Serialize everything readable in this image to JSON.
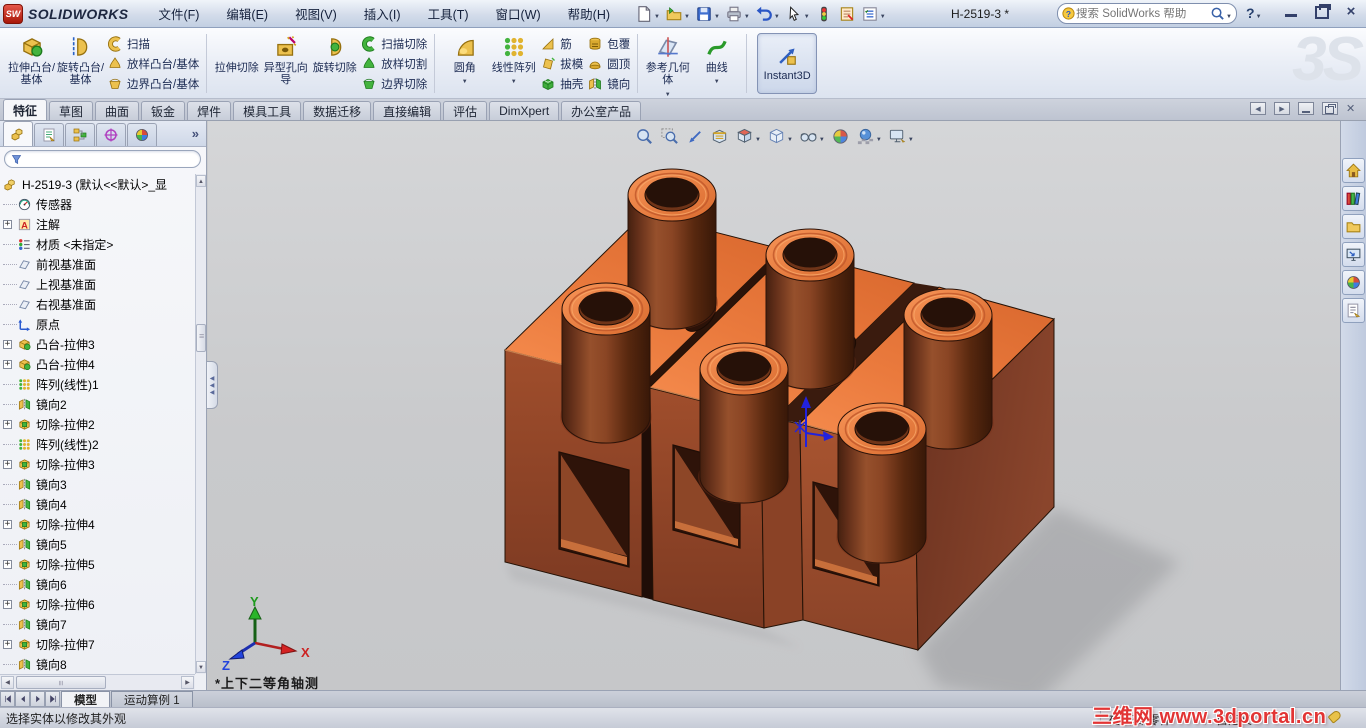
{
  "window": {
    "app_logo": "SOLIDWORKS",
    "logo_badge": "SW",
    "title": "H-2519-3 *",
    "search_placeholder": "搜索 SolidWorks 帮助",
    "help_label": "?"
  },
  "menus": [
    "文件(F)",
    "编辑(E)",
    "视图(V)",
    "插入(I)",
    "工具(T)",
    "窗口(W)",
    "帮助(H)"
  ],
  "quick_toolbar": [
    {
      "icon": "new-document-icon",
      "dropdown": true
    },
    {
      "icon": "open-icon",
      "dropdown": true
    },
    {
      "icon": "save-icon",
      "dropdown": true
    },
    {
      "icon": "print-icon",
      "dropdown": true
    },
    {
      "icon": "undo-icon",
      "dropdown": true
    },
    {
      "icon": "select-icon",
      "dropdown": true
    },
    {
      "icon": "traffic-light-icon",
      "dropdown": false
    },
    {
      "icon": "rebuild-icon",
      "dropdown": false
    },
    {
      "icon": "options-icon",
      "dropdown": true
    }
  ],
  "ribbon": {
    "g1": {
      "b1": "拉伸凸台/基体",
      "b2": "旋转凸台/基体",
      "s1": "扫描",
      "s2": "放样凸台/基体",
      "s3": "边界凸台/基体"
    },
    "g2": {
      "b1": "拉伸切除",
      "b2": "异型孔向导",
      "b3": "旋转切除",
      "s1": "扫描切除",
      "s2": "放样切割",
      "s3": "边界切除"
    },
    "g3": {
      "b1": "圆角",
      "b2": "线性阵列",
      "s1": "筋",
      "s2": "拔模",
      "s3": "抽壳",
      "s4": "包覆",
      "s5": "圆顶",
      "s6": "镜向"
    },
    "g4": {
      "b1": "参考几何体",
      "b2": "曲线"
    },
    "instant3d": "Instant3D",
    "watermark": "3S"
  },
  "command_tabs": [
    "特征",
    "草图",
    "曲面",
    "钣金",
    "焊件",
    "模具工具",
    "数据迁移",
    "直接编辑",
    "评估",
    "DimXpert",
    "办公室产品"
  ],
  "command_tabs_active": 0,
  "panel_tabs": [
    "featuremanager-icon",
    "propertymanager-icon",
    "configurations-icon",
    "dimxpert-icon",
    "displaymanager-icon"
  ],
  "feature_tree": {
    "root": "H-2519-3  (默认<<默认>_显",
    "items": [
      {
        "label": "传感器",
        "icon": "sensors-icon",
        "exp": false
      },
      {
        "label": "注解",
        "icon": "annotations-icon",
        "exp": true
      },
      {
        "label": "材质 <未指定>",
        "icon": "material-icon",
        "exp": false
      },
      {
        "label": "前视基准面",
        "icon": "plane-icon",
        "exp": false
      },
      {
        "label": "上视基准面",
        "icon": "plane-icon",
        "exp": false
      },
      {
        "label": "右视基准面",
        "icon": "plane-icon",
        "exp": false
      },
      {
        "label": "原点",
        "icon": "origin-icon",
        "exp": false
      },
      {
        "label": "凸台-拉伸3",
        "icon": "boss-extrude-icon",
        "exp": true
      },
      {
        "label": "凸台-拉伸4",
        "icon": "boss-extrude-icon",
        "exp": true
      },
      {
        "label": "阵列(线性)1",
        "icon": "linear-pattern-icon",
        "exp": false
      },
      {
        "label": "镜向2",
        "icon": "mirror-icon",
        "exp": false
      },
      {
        "label": "切除-拉伸2",
        "icon": "cut-extrude-icon",
        "exp": true
      },
      {
        "label": "阵列(线性)2",
        "icon": "linear-pattern-icon",
        "exp": false
      },
      {
        "label": "切除-拉伸3",
        "icon": "cut-extrude-icon",
        "exp": true
      },
      {
        "label": "镜向3",
        "icon": "mirror-icon",
        "exp": false
      },
      {
        "label": "镜向4",
        "icon": "mirror-icon",
        "exp": false
      },
      {
        "label": "切除-拉伸4",
        "icon": "cut-extrude-icon",
        "exp": true
      },
      {
        "label": "镜向5",
        "icon": "mirror-icon",
        "exp": false
      },
      {
        "label": "切除-拉伸5",
        "icon": "cut-extrude-icon",
        "exp": true
      },
      {
        "label": "镜向6",
        "icon": "mirror-icon",
        "exp": false
      },
      {
        "label": "切除-拉伸6",
        "icon": "cut-extrude-icon",
        "exp": true
      },
      {
        "label": "镜向7",
        "icon": "mirror-icon",
        "exp": false
      },
      {
        "label": "切除-拉伸7",
        "icon": "cut-extrude-icon",
        "exp": true
      },
      {
        "label": "镜向8",
        "icon": "mirror-icon",
        "exp": false
      }
    ]
  },
  "headsup": [
    {
      "icon": "zoom-fit-icon",
      "dropdown": false
    },
    {
      "icon": "zoom-area-icon",
      "dropdown": false
    },
    {
      "icon": "previous-view-icon",
      "dropdown": false
    },
    {
      "icon": "section-view-icon",
      "dropdown": false
    },
    {
      "icon": "view-orientation-icon",
      "dropdown": true
    },
    {
      "icon": "display-style-icon",
      "dropdown": true
    },
    {
      "icon": "hide-show-icon",
      "dropdown": true
    },
    {
      "icon": "edit-appearance-icon",
      "dropdown": false
    },
    {
      "icon": "apply-scene-icon",
      "dropdown": true
    },
    {
      "icon": "view-settings-icon",
      "dropdown": true
    }
  ],
  "taskpane": [
    "home-icon",
    "design-library-icon",
    "file-explorer-icon",
    "view-palette-icon",
    "appearances-icon",
    "custom-properties-icon"
  ],
  "viewport": {
    "view_label": "*上下二等角轴测",
    "triad_x": "X",
    "triad_y": "Y",
    "triad_z": "Z"
  },
  "bottom": {
    "doc_tabs": [
      {
        "label": "模型",
        "active": true
      },
      {
        "label": "运动算例 1",
        "active": false
      }
    ]
  },
  "statusbar": {
    "left": "选择实体以修改其外观",
    "editing": "在编辑 零件",
    "custom": "自定义",
    "watermark": "三维网 www.3dportal.cn"
  },
  "colors": {
    "model_top": "#ef7a3c",
    "model_front": "#94482a",
    "model_side": "#743622",
    "model_dark_recess": "#2e1309",
    "cylinder_body": "#7c3a1f",
    "viewport_background": "#cbccce",
    "origin_marker_blue": "#2222dd",
    "triad_x_red": "#cc2222",
    "triad_y_green": "#1c9a1c",
    "triad_z_blue": "#2244dd",
    "watermark_red": "#e23434",
    "titlebar_gradient": "#d3dcea",
    "ribbon_text": "#1b2a52"
  }
}
